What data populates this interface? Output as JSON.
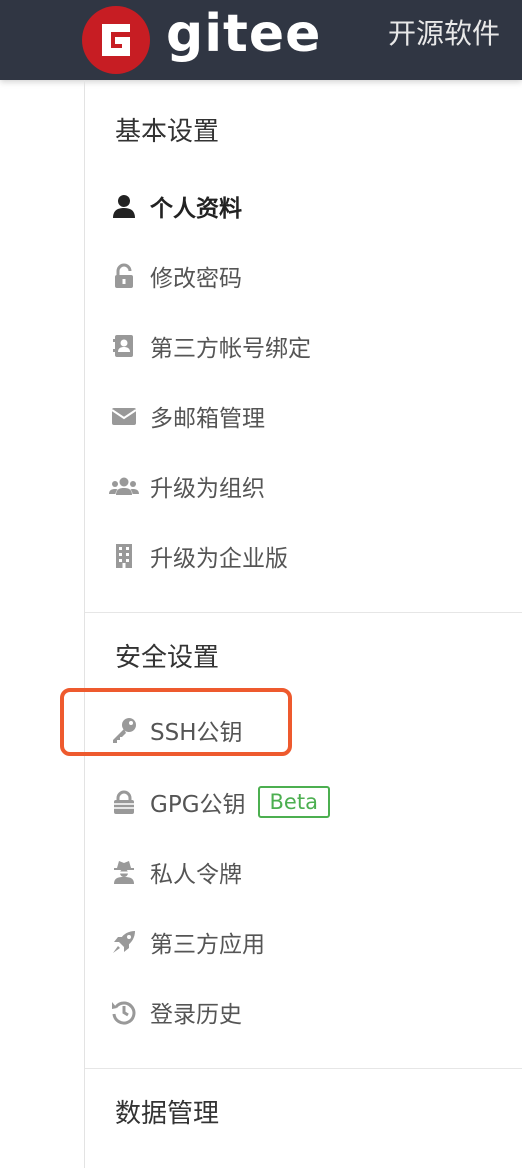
{
  "header": {
    "logo_text": "gitee",
    "nav_open_source": "开源软件"
  },
  "sections": {
    "basic": {
      "title": "基本设置",
      "items": [
        {
          "label": "个人资料",
          "icon": "user-icon",
          "active": true
        },
        {
          "label": "修改密码",
          "icon": "unlock-icon"
        },
        {
          "label": "第三方帐号绑定",
          "icon": "address-book-icon"
        },
        {
          "label": "多邮箱管理",
          "icon": "envelope-icon"
        },
        {
          "label": "升级为组织",
          "icon": "users-icon"
        },
        {
          "label": "升级为企业版",
          "icon": "building-icon"
        }
      ]
    },
    "security": {
      "title": "安全设置",
      "items": [
        {
          "label": "SSH公钥",
          "icon": "key-icon",
          "highlighted": true
        },
        {
          "label": "GPG公钥",
          "icon": "gpg-lock-icon",
          "badge": "Beta"
        },
        {
          "label": "私人令牌",
          "icon": "user-secret-icon"
        },
        {
          "label": "第三方应用",
          "icon": "rocket-icon"
        },
        {
          "label": "登录历史",
          "icon": "history-icon"
        }
      ]
    },
    "data": {
      "title": "数据管理"
    }
  },
  "colors": {
    "topbar_bg": "#303643",
    "logo_red": "#c71d23",
    "highlight_border": "#ee5a2e",
    "badge_green": "#4caf50"
  }
}
